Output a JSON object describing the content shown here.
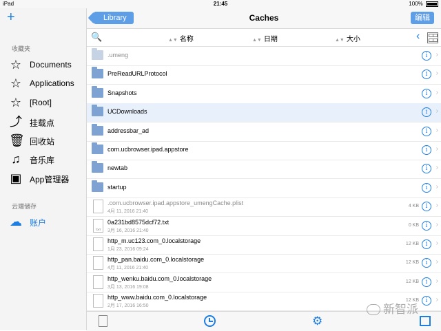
{
  "status": {
    "device": "iPad",
    "time": "21:45",
    "battery": "100%"
  },
  "sidebar": {
    "add_icon": "+",
    "favorites_header": "收藏夹",
    "items": [
      {
        "label": "Documents",
        "icon": "star-icon",
        "glyph": "☆"
      },
      {
        "label": "Applications",
        "icon": "star-icon",
        "glyph": "☆"
      },
      {
        "label": "[Root]",
        "icon": "star-icon",
        "glyph": "☆"
      },
      {
        "label": "挂载点",
        "icon": "mount-icon",
        "glyph": "⤴"
      },
      {
        "label": "回收站",
        "icon": "trash-icon",
        "glyph": "🗑"
      },
      {
        "label": "音乐库",
        "icon": "music-folder-icon",
        "glyph": "♫"
      },
      {
        "label": "App管理器",
        "icon": "app-folder-icon",
        "glyph": "▣"
      }
    ],
    "cloud_header": "云端储存",
    "cloud_items": [
      {
        "label": "账户",
        "icon": "cloud-icon",
        "glyph": "☁"
      }
    ]
  },
  "nav": {
    "back_label": "Library",
    "title": "Caches",
    "edit_label": "编辑"
  },
  "sort": {
    "name": "名称",
    "date": "日期",
    "size": "大小"
  },
  "files": [
    {
      "name": ".umeng",
      "type": "folder",
      "dim": true,
      "date": "",
      "size": ""
    },
    {
      "name": "PreReadURLProtocol",
      "type": "folder",
      "date": "",
      "size": ""
    },
    {
      "name": "Snapshots",
      "type": "folder",
      "date": "",
      "size": ""
    },
    {
      "name": "UCDownloads",
      "type": "folder",
      "selected": true,
      "date": "",
      "size": ""
    },
    {
      "name": "addressbar_ad",
      "type": "folder",
      "date": "",
      "size": ""
    },
    {
      "name": "com.ucbrowser.ipad.appstore",
      "type": "folder",
      "date": "",
      "size": ""
    },
    {
      "name": "newtab",
      "type": "folder",
      "date": "",
      "size": ""
    },
    {
      "name": "startup",
      "type": "folder",
      "date": "",
      "size": ""
    },
    {
      "name": ".com.ucbrowser.ipad.appstore_umengCache.plist",
      "type": "file",
      "dim": true,
      "date": "4月 11, 2016 21:40",
      "size": "4 KB"
    },
    {
      "name": "0a231bd8575dcf72.txt",
      "type": "txt",
      "date": "3月 16, 2016 21:40",
      "size": "0 KB"
    },
    {
      "name": "http_m.uc123.com_0.localstorage",
      "type": "file",
      "date": "1月 23, 2016 09:24",
      "size": "12 KB"
    },
    {
      "name": "http_pan.baidu.com_0.localstorage",
      "type": "file",
      "date": "4月 11, 2016 21:40",
      "size": "12 KB"
    },
    {
      "name": "http_wenku.baidu.com_0.localstorage",
      "type": "file",
      "date": "3月 13, 2016 19:08",
      "size": "12 KB"
    },
    {
      "name": "http_www.baidu.com_0.localstorage",
      "type": "file",
      "date": "2月 17, 2016 16:50",
      "size": "12 KB"
    }
  ],
  "txt_label": "TXT",
  "watermark": "新智派",
  "colors": {
    "accent": "#1e7de0",
    "button": "#5d9ee6",
    "folder": "#7ea3d3"
  }
}
